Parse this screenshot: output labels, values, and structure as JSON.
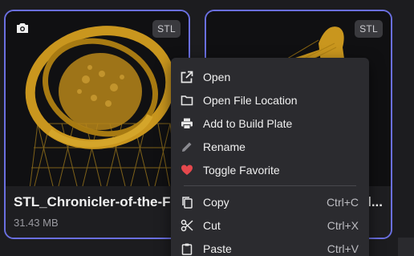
{
  "cards": [
    {
      "badge": "STL",
      "title": "STL_Chronicler-of-the-Fl",
      "size": "31.43 MB"
    },
    {
      "badge": "STL",
      "title": "l...",
      "size": ""
    }
  ],
  "context_menu": {
    "items": [
      {
        "label": "Open",
        "icon": "open-external-icon",
        "shortcut": ""
      },
      {
        "label": "Open File Location",
        "icon": "folder-icon",
        "shortcut": ""
      },
      {
        "label": "Add to Build Plate",
        "icon": "printer-icon",
        "shortcut": ""
      },
      {
        "label": "Rename",
        "icon": "pencil-icon",
        "shortcut": ""
      },
      {
        "label": "Toggle Favorite",
        "icon": "heart-icon",
        "shortcut": ""
      },
      {
        "label": "Copy",
        "icon": "copy-icon",
        "shortcut": "Ctrl+C"
      },
      {
        "label": "Cut",
        "icon": "scissors-icon",
        "shortcut": "Ctrl+X"
      },
      {
        "label": "Paste",
        "icon": "clipboard-icon",
        "shortcut": "Ctrl+V"
      }
    ]
  },
  "colors": {
    "card_border": "#6a6fe0",
    "model_gold": "#c9961e",
    "favorite_red": "#e5484d"
  }
}
